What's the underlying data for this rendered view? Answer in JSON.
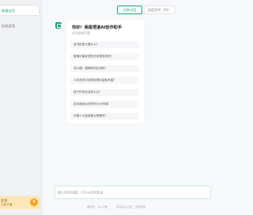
{
  "sidebar": {
    "new_chat_label": "新建会话",
    "history_item_label": "历史会话",
    "promo": {
      "title": "会员",
      "subtitle": "立即开通",
      "badge": "¥"
    }
  },
  "header": {
    "modes": [
      {
        "label": "日常对话",
        "active": true
      },
      {
        "label": "深度思考（R1）",
        "active": false
      }
    ]
  },
  "welcome": {
    "title": "你好！我是悟道AI创作助手",
    "subtitle": "试试这样问我",
    "suggestions": [
      "读书的意义是什么？",
      "爱情中最优质的关系是怎样的？",
      "怎么做一道美味的红烧肉？",
      "人际关系中如何处理冲突和矛盾？",
      "孩子厌学应该怎么办？",
      "告诉我适合创作的10大领域",
      "中国十大旅游景点是哪些？"
    ]
  },
  "input": {
    "placeholder": "输入您的问题，Ctrl+回车发送"
  },
  "footer": {
    "left": "备案号：京ICP备",
    "right": "内容由AI生成，仅供参考"
  },
  "colors": {
    "accent": "#1aa37a",
    "promo_bg": "#fde7b8",
    "badge": "#f5a623"
  }
}
